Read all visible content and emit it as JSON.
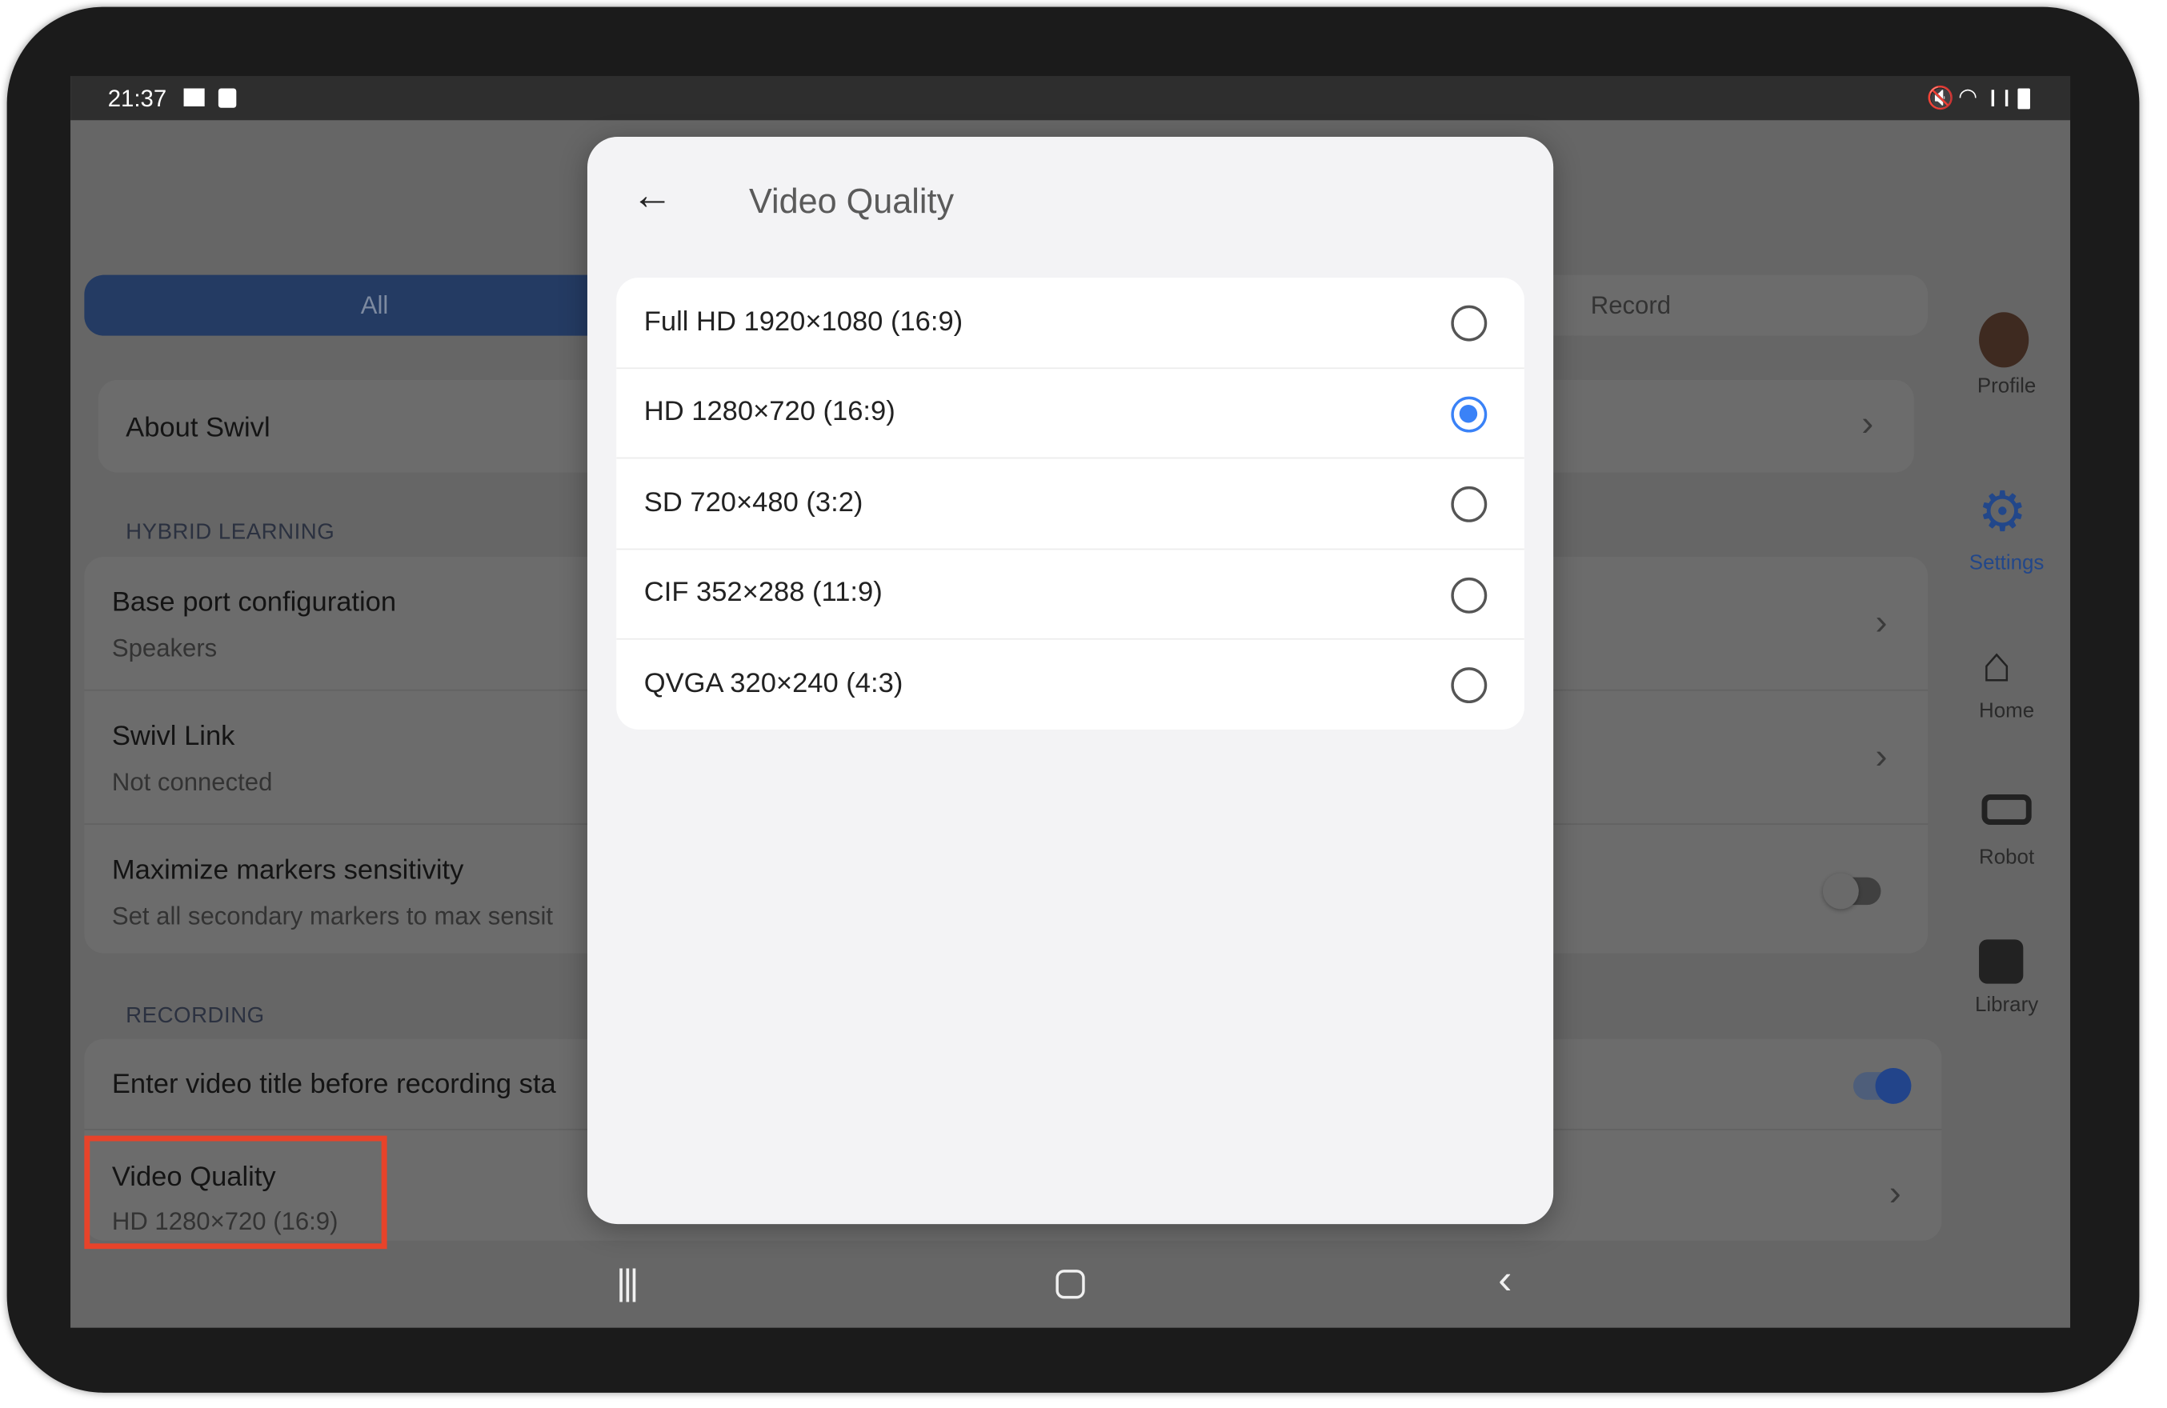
{
  "status_bar": {
    "time": "21:37",
    "icons_left": [
      "image-icon",
      "screenshot-icon"
    ],
    "icons_right": [
      "mute-icon",
      "wifi-icon",
      "signal-icon",
      "battery-icon"
    ]
  },
  "tabs": {
    "all": "All",
    "record": "Record"
  },
  "settings": {
    "about": "About Swivl",
    "hybrid_header": "HYBRID LEARNING",
    "base_port": {
      "title": "Base port configuration",
      "subtitle": "Speakers"
    },
    "swivl_link": {
      "title": "Swivl Link",
      "subtitle": "Not connected"
    },
    "markers": {
      "title": "Maximize markers sensitivity",
      "subtitle": "Set all secondary markers to max sensit",
      "toggle_on": false
    },
    "recording_header": "RECORDING",
    "enter_title": {
      "title": "Enter video title before recording sta",
      "toggle_on": true
    },
    "video_quality": {
      "title": "Video Quality",
      "subtitle": "HD 1280×720 (16:9)"
    }
  },
  "rail": {
    "profile": "Profile",
    "settings": "Settings",
    "home": "Home",
    "robot": "Robot",
    "library": "Library"
  },
  "dialog": {
    "title": "Video Quality",
    "options": [
      {
        "label": "Full HD 1920×1080 (16:9)",
        "selected": false
      },
      {
        "label": "HD 1280×720 (16:9)",
        "selected": true
      },
      {
        "label": "SD 720×480 (3:2)",
        "selected": false
      },
      {
        "label": "CIF 352×288 (11:9)",
        "selected": false
      },
      {
        "label": "QVGA 320×240 (4:3)",
        "selected": false
      }
    ]
  },
  "colors": {
    "accent": "#3a82f7",
    "highlight_box": "#e8432a",
    "tab_active": "#3a5fa8"
  }
}
